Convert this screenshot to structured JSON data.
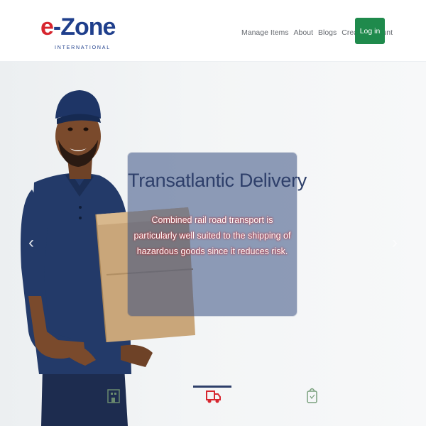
{
  "logo": {
    "main_e": "e",
    "main_rest": "-Zone",
    "sub": "INTERNATIONAL"
  },
  "nav": {
    "links": [
      "Manage Items",
      "About",
      "Blogs",
      "Create Account"
    ],
    "login": "Log in"
  },
  "slide": {
    "title": "Transatlantic Delivery",
    "text": "Combined rail road transport is particularly well suited to the shipping of hazardous goods since it reduces risk."
  },
  "carousel": {
    "prev": "‹",
    "next": "›",
    "indicators": [
      "building-icon",
      "truck-icon",
      "shopping-bag-icon"
    ],
    "active_index": 1
  },
  "colors": {
    "accent_green": "#1f8a4c",
    "brand_blue": "#1f3f8c",
    "brand_red": "#d7262f",
    "caption_bg": "#364e82"
  }
}
